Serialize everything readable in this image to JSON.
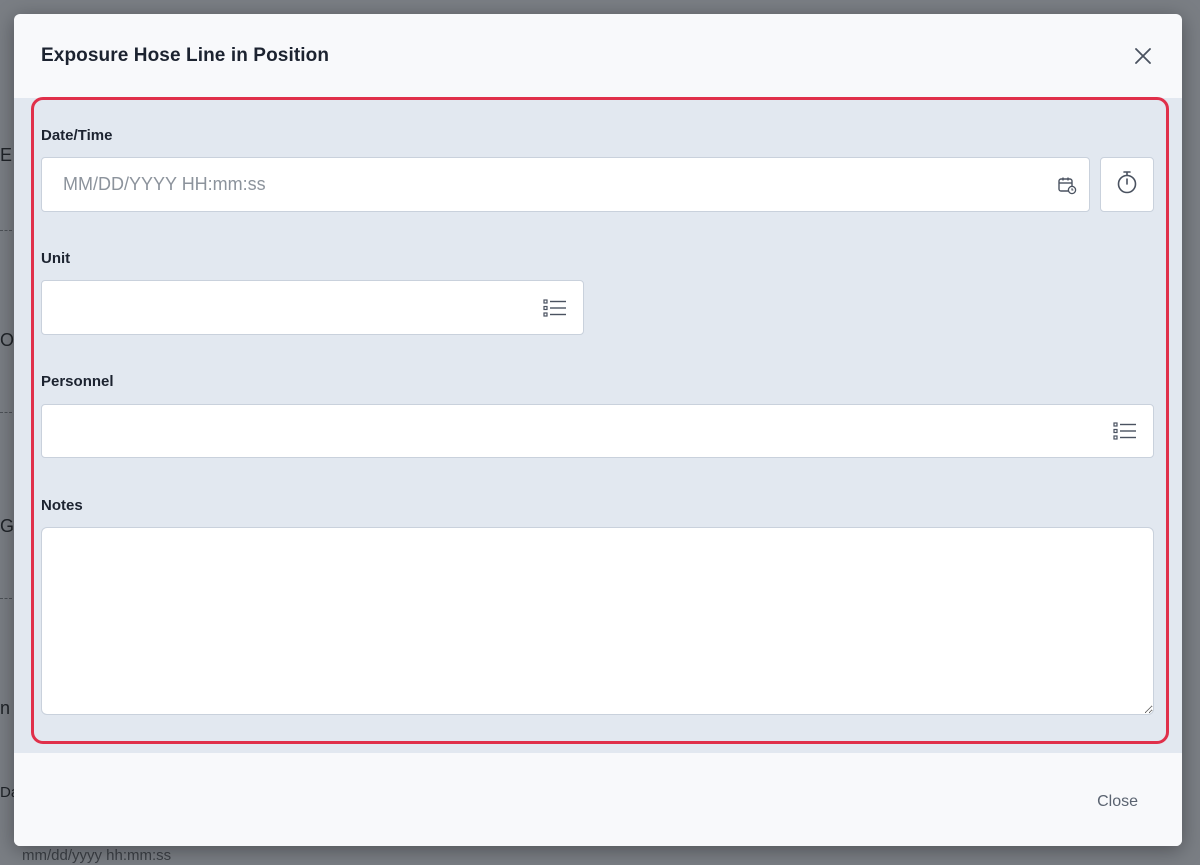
{
  "dialog": {
    "title": "Exposure Hose Line in Position",
    "close_label": "Close"
  },
  "fields": {
    "datetime": {
      "label": "Date/Time",
      "placeholder": "MM/DD/YYYY HH:mm:ss",
      "value": "",
      "icon": "calendar-clock-icon",
      "side_button_icon": "stopwatch-icon"
    },
    "unit": {
      "label": "Unit",
      "value": "",
      "icon": "list-icon"
    },
    "personnel": {
      "label": "Personnel",
      "value": "",
      "icon": "list-icon"
    },
    "notes": {
      "label": "Notes",
      "value": ""
    }
  },
  "background": {
    "fragments": [
      "E",
      "O",
      "G",
      "n",
      "Da"
    ],
    "bottom_text": "mm/dd/yyyy hh:mm:ss"
  },
  "colors": {
    "highlight": "#e0304a",
    "body_bg": "#e2e8f0",
    "text": "#1c2330"
  }
}
